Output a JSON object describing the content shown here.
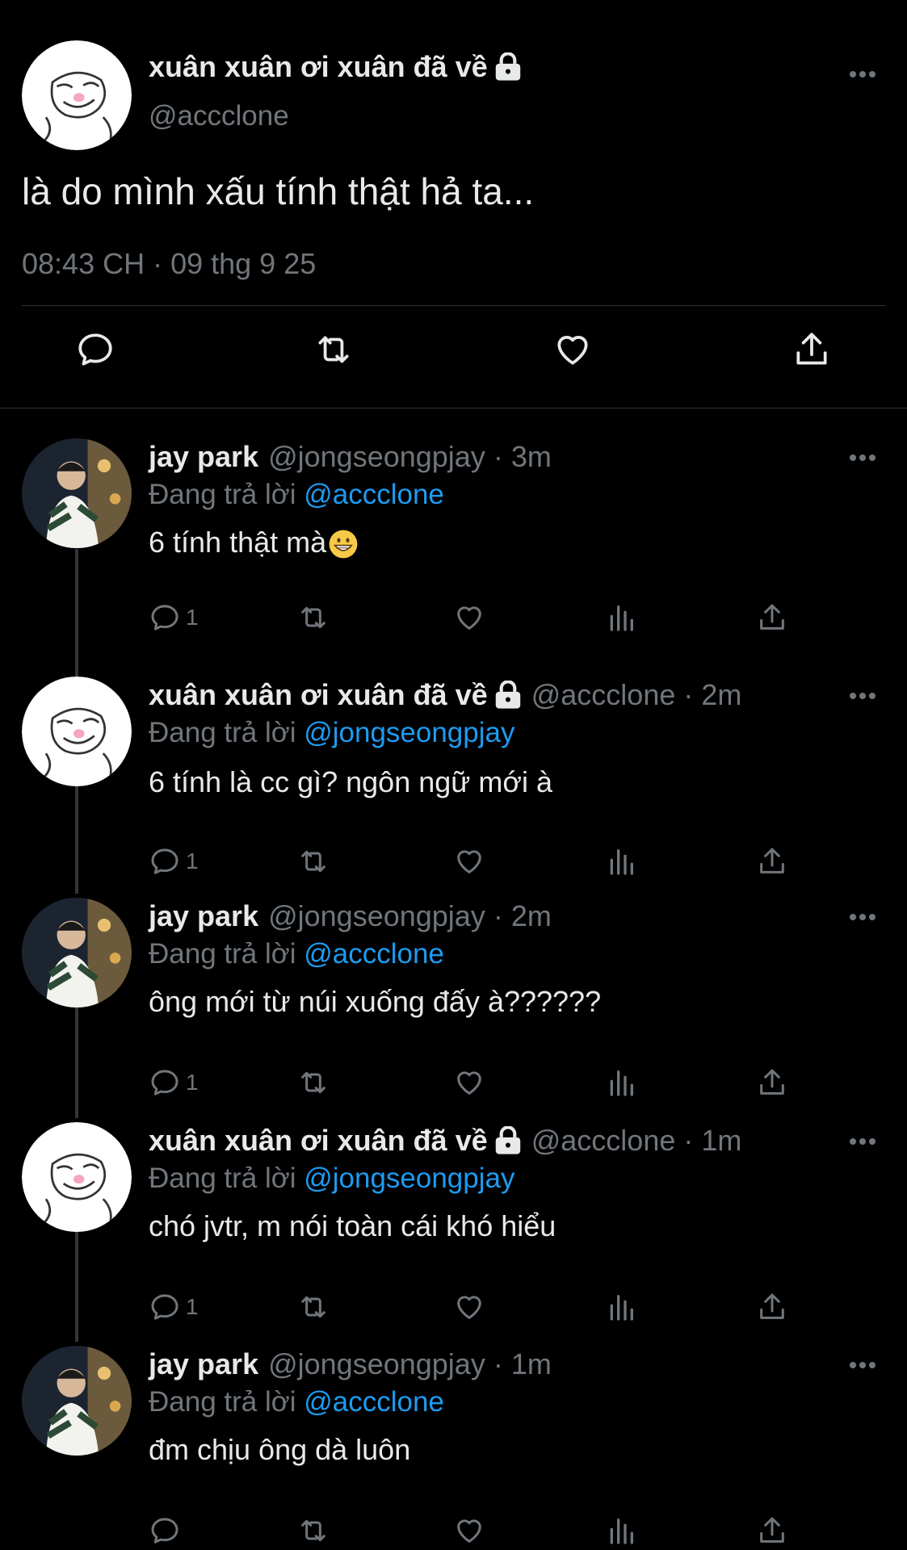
{
  "main": {
    "name": "xuân xuân ơi xuân đã về",
    "handle": "@accclone",
    "text": "là do mình xấu tính thật hả ta...",
    "timestamp": "08:43 CH · 09 thg 9 25"
  },
  "replies": [
    {
      "name": "jay park",
      "meta": "@jongseongpjay · 3m",
      "replying_label": "Đang trả lời ",
      "mention": "@accclone",
      "text": "6 tính thật mà",
      "emoji": "grinning-face",
      "reply_count": "1"
    },
    {
      "name": "xuân xuân ơi xuân đã về",
      "meta": "@accclone · 2m",
      "replying_label": "Đang trả lời ",
      "mention": "@jongseongpjay",
      "text": "6 tính là cc gì? ngôn ngữ mới à",
      "reply_count": "1"
    },
    {
      "name": "jay park",
      "meta": "@jongseongpjay · 2m",
      "replying_label": "Đang trả lời ",
      "mention": "@accclone",
      "text": "ông mới từ núi xuống đấy à??????",
      "reply_count": "1"
    },
    {
      "name": "xuân xuân ơi xuân đã về",
      "meta": "@accclone · 1m",
      "replying_label": "Đang trả lời ",
      "mention": "@jongseongpjay",
      "text": "chó jvtr, m nói toàn cái khó hiểu",
      "reply_count": "1"
    },
    {
      "name": "jay park",
      "meta": "@jongseongpjay · 1m",
      "replying_label": "Đang trả lời ",
      "mention": "@accclone",
      "text": "đm chịu ông dà luôn",
      "reply_count": ""
    }
  ],
  "colors": {
    "background": "#000000",
    "text": "#e7e9ea",
    "muted": "#71767b",
    "mention": "#1d9bf0",
    "divider": "#2f3336"
  }
}
